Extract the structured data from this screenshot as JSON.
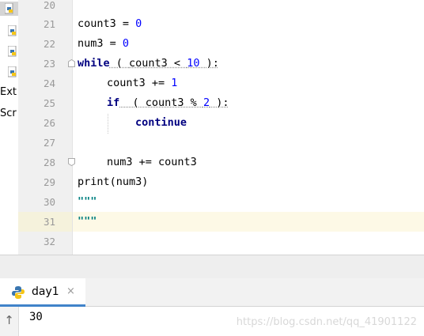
{
  "project_panel": {
    "items": [
      "Ext",
      "Scr"
    ]
  },
  "gutter": {
    "line_numbers": [
      "20",
      "21",
      "22",
      "23",
      "24",
      "25",
      "26",
      "27",
      "28",
      "29",
      "30",
      "31",
      "32"
    ]
  },
  "code": {
    "line21": {
      "var": "count3",
      "op": " = ",
      "val": "0"
    },
    "line22": {
      "var": "num3",
      "op": " = ",
      "val": "0"
    },
    "line23": {
      "kw": "while",
      "open": " ( ",
      "cond": "count3 < ",
      "num": "10",
      "close": " ):"
    },
    "line24": {
      "var": "count3",
      "op": " += ",
      "val": "1"
    },
    "line25": {
      "kw": "if",
      "open": "  ( ",
      "cond": "count3 % ",
      "num": "2",
      "close": " ):"
    },
    "line26": {
      "kw": "continue"
    },
    "line28": {
      "text": "num3 += count3"
    },
    "line29": {
      "text": "print(num3)"
    },
    "line30": {
      "str": "\"\"\""
    },
    "line31": {
      "str": "\"\"\""
    }
  },
  "run_panel": {
    "tab_label": "day1",
    "close_icon": "×",
    "output": "30",
    "up_icon": "↑"
  },
  "watermark": "https://blog.csdn.net/qq_41901122",
  "colors": {
    "keyword": "#000080",
    "number": "#0000ff",
    "string": "#008080",
    "current_line": "#fdf9e6",
    "tab_accent": "#4083c9"
  }
}
